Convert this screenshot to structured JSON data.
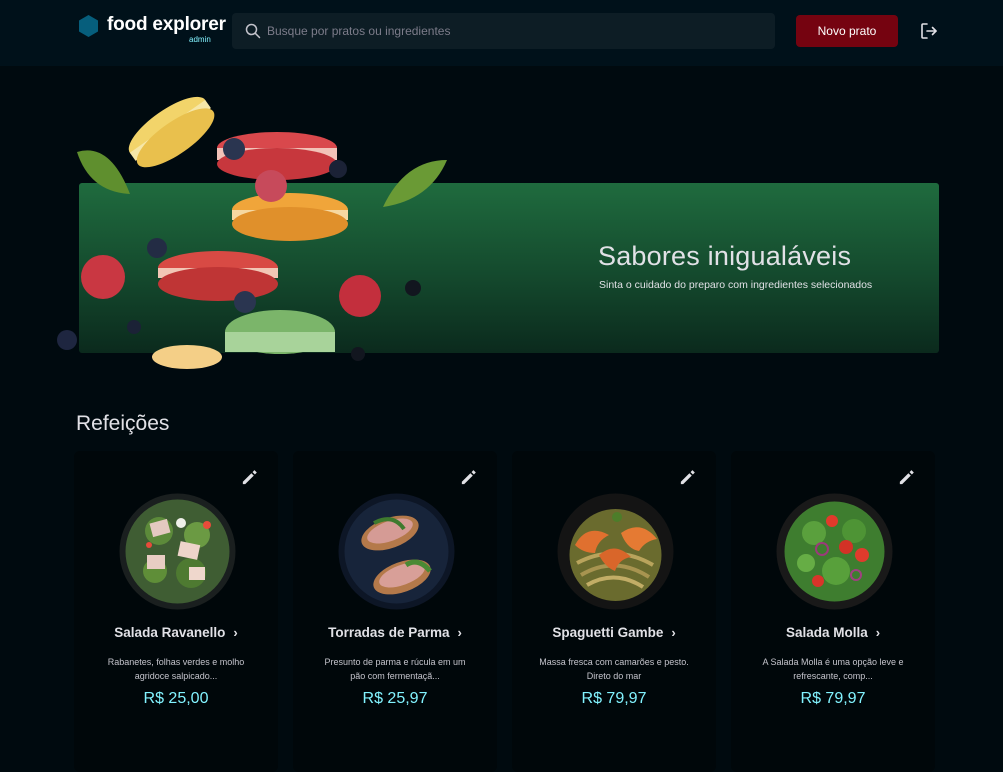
{
  "header": {
    "logo_name": "food explorer",
    "logo_badge": "admin",
    "search_placeholder": "Busque por pratos ou ingredientes",
    "new_button": "Novo prato"
  },
  "banner": {
    "title": "Sabores inigualáveis",
    "subtitle": "Sinta o cuidado do preparo com ingredientes selecionados"
  },
  "section": {
    "title": "Refeições"
  },
  "colors": {
    "accent": "#82f3ff",
    "button": "#750310",
    "banner": "#1f6b3e"
  },
  "cards": [
    {
      "name": "Salada Ravanello",
      "description": "Rabanetes, folhas verdes e molho agridoce salpicado...",
      "price": "R$ 25,00"
    },
    {
      "name": "Torradas de Parma",
      "description": "Presunto de parma e rúcula em um pão com fermentaçã...",
      "price": "R$ 25,97"
    },
    {
      "name": "Spaguetti Gambe",
      "description": "Massa fresca com camarões e pesto. Direto do mar",
      "price": "R$ 79,97"
    },
    {
      "name": "Salada Molla",
      "description": "A Salada Molla é uma opção leve e refrescante, comp...",
      "price": "R$ 79,97"
    }
  ]
}
